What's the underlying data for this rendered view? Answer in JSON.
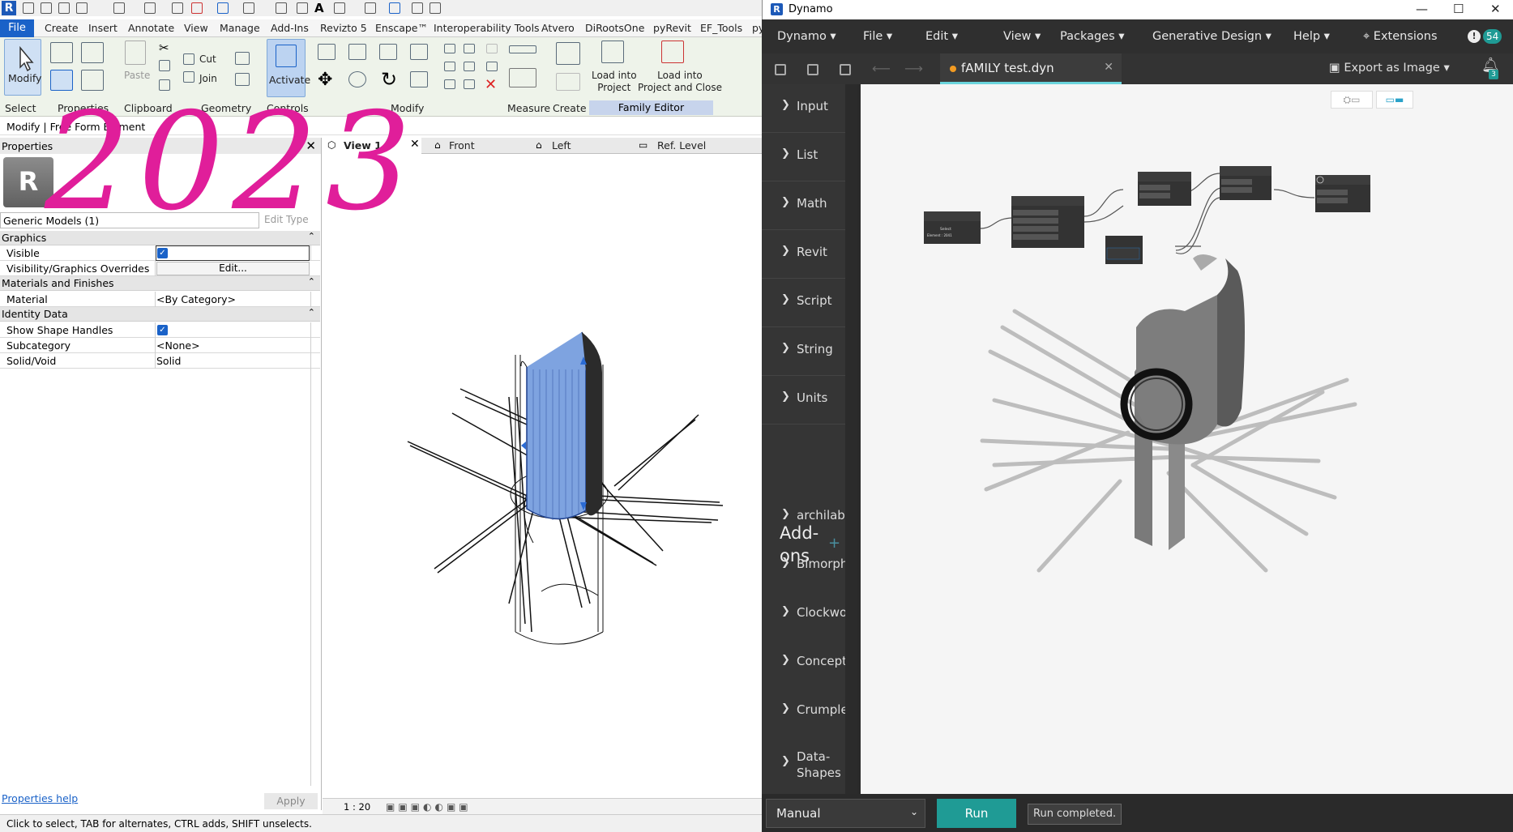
{
  "revit": {
    "ribbon_tabs": [
      "File",
      "Create",
      "Insert",
      "Annotate",
      "View",
      "Manage",
      "Add-Ins",
      "Revizto 5",
      "Enscape™",
      "Interoperability Tools",
      "Atvero",
      "DiRootsOne",
      "pyRevit",
      "EF_Tools",
      "py"
    ],
    "buttons": {
      "modify": "Modify",
      "paste": "Paste",
      "cut": "Cut",
      "join": "Join",
      "activate": "Activate",
      "load_into_project": "Load into\nProject",
      "load_close": "Load into\nProject and Close"
    },
    "groups": {
      "select": "Select",
      "properties": "Properties",
      "clipboard": "Clipboard",
      "geometry": "Geometry",
      "controls": "Controls",
      "modify": "Modify",
      "measure": "Measure",
      "create": "Create",
      "family_editor": "Family Editor"
    },
    "context_bar": "Modify | Free Form Element",
    "properties": {
      "title": "Properties",
      "type_dropdown": "Generic Models (1)",
      "edit_type": "Edit Type",
      "sections": {
        "graphics": "Graphics",
        "materials": "Materials and Finishes",
        "identity": "Identity Data"
      },
      "rows": {
        "visible": {
          "label": "Visible",
          "checked": true
        },
        "vg_overrides": {
          "label": "Visibility/Graphics Overrides",
          "value": "Edit..."
        },
        "material": {
          "label": "Material",
          "value": "<By Category>"
        },
        "show_handles": {
          "label": "Show Shape Handles",
          "checked": true
        },
        "subcategory": {
          "label": "Subcategory",
          "value": "<None>"
        },
        "solid_void": {
          "label": "Solid/Void",
          "value": "Solid"
        }
      },
      "help": "Properties help",
      "apply": "Apply"
    },
    "view_tabs": [
      "View 1",
      "Front",
      "Left",
      "Ref. Level"
    ],
    "scale": "1 : 20",
    "status": "Click to select, TAB for alternates, CTRL adds, SHIFT unselects.",
    "annotation_year": "2023"
  },
  "dynamo": {
    "window_title": "Dynamo",
    "menus": [
      "Dynamo",
      "File",
      "Edit",
      "View",
      "Packages",
      "Generative Design",
      "Help"
    ],
    "extensions": "Extensions",
    "notif_count": "54",
    "bell_count": "3",
    "file_tab": "fAMILY test.dyn",
    "export": "Export as Image",
    "library": [
      "Input",
      "List",
      "Math",
      "Revit",
      "Script",
      "String",
      "Units"
    ],
    "addons_title": "Add-\nons",
    "addons": [
      "archilab",
      "Bimorph",
      "Clockwor",
      "Conceptu",
      "Crumple",
      "Data-\nShapes"
    ],
    "run_mode": "Manual",
    "run": "Run",
    "run_status": "Run completed.",
    "colors": {
      "accent": "#1f9b95",
      "tab_underline": "#6ad4dc",
      "unsaved_dot": "#f29b22"
    }
  }
}
